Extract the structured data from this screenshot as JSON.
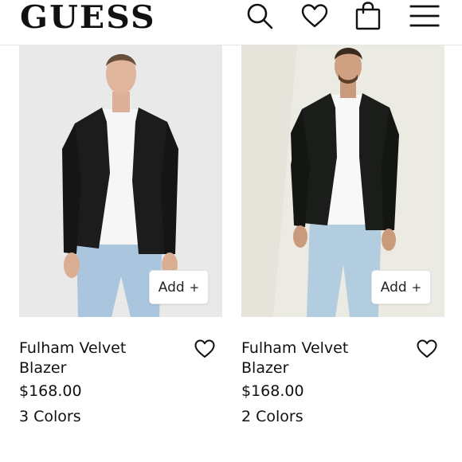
{
  "header": {
    "logo": "GUESS",
    "icons": [
      "search-icon",
      "heart-icon",
      "bag-icon",
      "menu-icon"
    ]
  },
  "products": [
    {
      "name": "Fulham Velvet Blazer",
      "price": "$168.00",
      "colors": "3 Colors",
      "add_label": "Add",
      "add_icon": "+"
    },
    {
      "name": "Fulham Velvet Blazer",
      "price": "$168.00",
      "colors": "2 Colors",
      "add_label": "Add",
      "add_icon": "+"
    }
  ],
  "palette": {
    "text": "#111111",
    "photo_bg_left": "#e9e9e9",
    "photo_bg_right": "#ecebe3",
    "blazer": "#1c1c1c",
    "jeans": "#a9c6de"
  }
}
